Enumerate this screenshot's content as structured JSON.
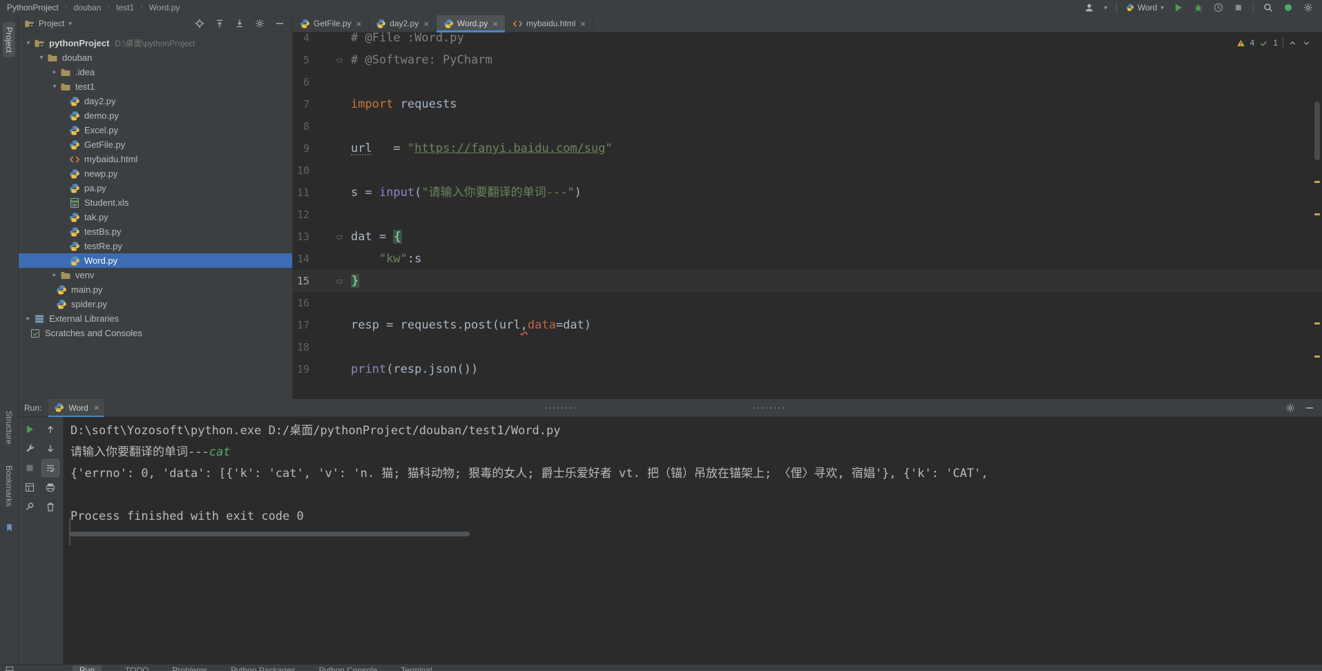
{
  "colors": {
    "panel": "#3c3f41",
    "editor_bg": "#2b2b2b",
    "selection_blue": "#3c6cb4",
    "accent_green": "#499c54",
    "keyword_orange": "#cc7832",
    "string_green": "#6a8759",
    "builtin_purple": "#8888c6",
    "comment_gray": "#808080",
    "warning_yellow": "#d6a243",
    "tab_underline": "#4a88c7"
  },
  "titlebar": {
    "breadcrumbs": [
      "PythonProject",
      "douban",
      "test1",
      "Word.py"
    ],
    "run_config": "Word"
  },
  "left_stripe": {
    "top_label": "Project",
    "bottom_labels": [
      "Structure",
      "Bookmarks"
    ]
  },
  "project_panel": {
    "header": "Project",
    "tree": [
      {
        "indent": 0,
        "chev": "down",
        "icon": "project",
        "label": "pythonProject",
        "suffix": "D:\\桌面\\pythonProject",
        "bold": true
      },
      {
        "indent": 1,
        "chev": "down",
        "icon": "folder",
        "label": "douban"
      },
      {
        "indent": 2,
        "chev": "right",
        "icon": "folder",
        "label": ".idea"
      },
      {
        "indent": 2,
        "chev": "down",
        "icon": "folder",
        "label": "test1"
      },
      {
        "indent": 3,
        "icon": "py",
        "label": "day2.py"
      },
      {
        "indent": 3,
        "icon": "py",
        "label": "demo.py"
      },
      {
        "indent": 3,
        "icon": "py",
        "label": "Excel.py"
      },
      {
        "indent": 3,
        "icon": "py",
        "label": "GetFile.py"
      },
      {
        "indent": 3,
        "icon": "html",
        "label": "mybaidu.html"
      },
      {
        "indent": 3,
        "icon": "py",
        "label": "newp.py"
      },
      {
        "indent": 3,
        "icon": "py",
        "label": "pa.py"
      },
      {
        "indent": 3,
        "icon": "xls",
        "label": "Student.xls"
      },
      {
        "indent": 3,
        "icon": "py",
        "label": "tak.py"
      },
      {
        "indent": 3,
        "icon": "py",
        "label": "testBs.py"
      },
      {
        "indent": 3,
        "icon": "py",
        "label": "testRe.py"
      },
      {
        "indent": 3,
        "icon": "py",
        "label": "Word.py",
        "selected": true
      },
      {
        "indent": 2,
        "chev": "right",
        "icon": "folder",
        "label": "venv"
      },
      {
        "indent": 2,
        "icon": "py",
        "label": "main.py"
      },
      {
        "indent": 2,
        "icon": "py",
        "label": "spider.py"
      },
      {
        "indent": 0,
        "chev": "right",
        "icon": "lib",
        "label": "External Libraries"
      },
      {
        "indent": 0,
        "icon": "scratch",
        "label": "Scratches and Consoles"
      }
    ]
  },
  "editor": {
    "tabs": [
      {
        "icon": "py",
        "label": "GetFile.py"
      },
      {
        "icon": "py",
        "label": "day2.py"
      },
      {
        "icon": "py",
        "label": "Word.py",
        "active": true
      },
      {
        "icon": "html",
        "label": "mybaidu.html"
      }
    ],
    "inspections": {
      "warning_count": "4",
      "ok_count": "1"
    },
    "lines": [
      {
        "num": 4,
        "segs": [
          [
            "cmt",
            "# @File :Word.py"
          ]
        ]
      },
      {
        "num": 5,
        "fold": true,
        "segs": [
          [
            "cmt",
            "# @Software: PyCharm"
          ]
        ]
      },
      {
        "num": 6,
        "segs": []
      },
      {
        "num": 7,
        "segs": [
          [
            "kw",
            "import"
          ],
          [
            "pln",
            " requests"
          ]
        ]
      },
      {
        "num": 8,
        "segs": []
      },
      {
        "num": 9,
        "segs": [
          [
            "typo",
            "url"
          ],
          [
            "pln",
            "   = "
          ],
          [
            "str",
            "\""
          ],
          [
            "strU",
            "https://fanyi.baidu.com/sug"
          ],
          [
            "str",
            "\""
          ]
        ]
      },
      {
        "num": 10,
        "segs": []
      },
      {
        "num": 11,
        "segs": [
          [
            "pln",
            "s = "
          ],
          [
            "bi",
            "input"
          ],
          [
            "pln",
            "("
          ],
          [
            "str",
            "\"请输入你要翻译的单词---\""
          ],
          [
            "pln",
            ")"
          ]
        ]
      },
      {
        "num": 12,
        "segs": []
      },
      {
        "num": 13,
        "fold": true,
        "segs": [
          [
            "pln",
            "dat = "
          ],
          [
            "brace",
            "{"
          ]
        ]
      },
      {
        "num": 14,
        "segs": [
          [
            "pln",
            "    "
          ],
          [
            "str",
            "\"kw\""
          ],
          [
            "pln",
            ":s"
          ]
        ]
      },
      {
        "num": 15,
        "fold": true,
        "current": true,
        "segs": [
          [
            "brace",
            "}"
          ]
        ]
      },
      {
        "num": 16,
        "segs": []
      },
      {
        "num": 17,
        "segs": [
          [
            "pln",
            "resp = requests.post(url"
          ],
          [
            "sqr",
            ","
          ],
          [
            "par",
            "data"
          ],
          [
            "pln",
            "=dat)"
          ]
        ]
      },
      {
        "num": 18,
        "segs": []
      },
      {
        "num": 19,
        "segs": [
          [
            "bi",
            "print"
          ],
          [
            "pln",
            "(resp.json())"
          ]
        ]
      }
    ]
  },
  "run_panel": {
    "label": "Run:",
    "tab": "Word",
    "toolbar_col1": [
      "rerun",
      "wrench",
      "stop",
      "layout",
      "pin"
    ],
    "toolbar_col2": [
      "up",
      "down",
      "wrap",
      "print",
      "trash"
    ],
    "console": [
      [
        [
          "out",
          "D:\\soft\\Yozosoft\\python.exe D:/桌面/pythonProject/douban/test1/Word.py"
        ]
      ],
      [
        [
          "out",
          "请输入你要翻译的单词---"
        ],
        [
          "in",
          "cat"
        ]
      ],
      [
        [
          "out",
          "{'errno': 0, 'data': [{'k': 'cat', 'v': 'n. 猫; 猫科动物; 狠毒的女人; 爵士乐爱好者 vt. 把（锚）吊放在锚架上; 〈俚〉寻欢, 宿娼'}, {'k': 'CAT',"
        ]
      ],
      [],
      [
        [
          "out",
          "Process finished with exit code 0"
        ]
      ]
    ]
  },
  "status_bar": {
    "items": [
      {
        "label": "Run",
        "active": true
      },
      {
        "label": "TODO"
      },
      {
        "label": "Problems"
      },
      {
        "label": "Python Packages"
      },
      {
        "label": "Python Console"
      },
      {
        "label": "Terminal"
      }
    ]
  }
}
